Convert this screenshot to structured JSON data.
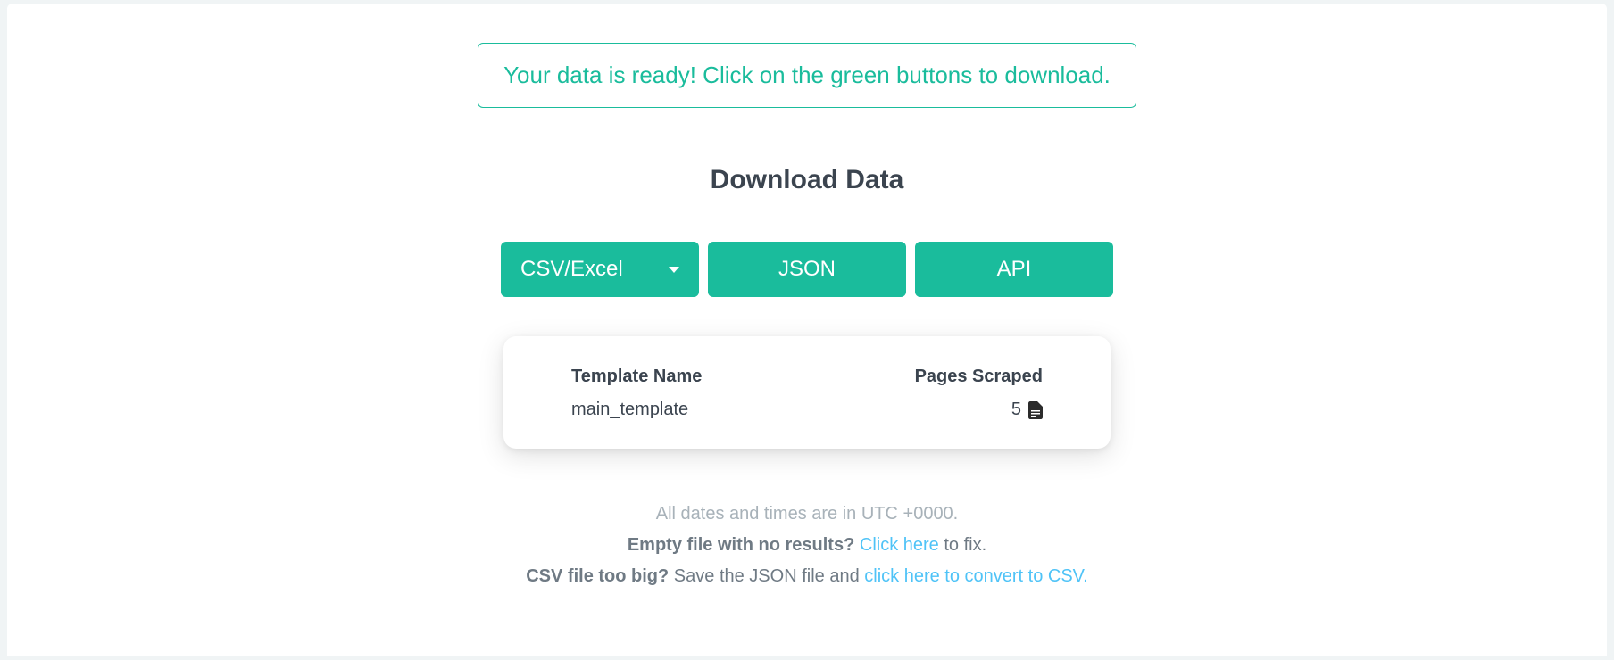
{
  "alert": {
    "message": "Your data is ready! Click on the green buttons to download."
  },
  "title": "Download Data",
  "buttons": {
    "csv_excel": "CSV/Excel",
    "json": "JSON",
    "api": "API"
  },
  "table": {
    "headers": {
      "template_name": "Template Name",
      "pages_scraped": "Pages Scraped"
    },
    "rows": [
      {
        "template_name": "main_template",
        "pages_scraped": "5"
      }
    ]
  },
  "footer": {
    "line1": "All dates and times are in UTC +0000.",
    "line2_bold": "Empty file with no results?",
    "line2_link": "Click here",
    "line2_rest": " to fix.",
    "line3_bold": "CSV file too big?",
    "line3_mid": " Save the JSON file and ",
    "line3_link": "click here to convert to CSV."
  }
}
